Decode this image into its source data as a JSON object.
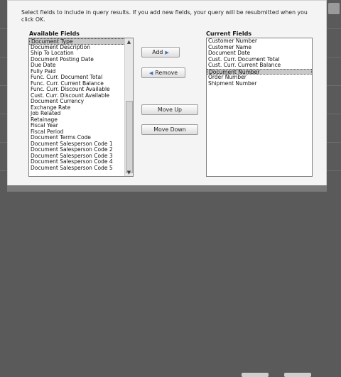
{
  "instructions": "Select fields to include in query results. If you add new fields, your query will be resubmitted when you click OK.",
  "available": {
    "label": "Available Fields",
    "items": [
      "Document Type",
      "Document Description",
      "Ship To Location",
      "Document Posting Date",
      "Due Date",
      "Fully Paid",
      "Func. Curr. Document Total",
      "Func. Curr. Current Balance",
      "Func. Curr. Discount Available",
      "Cust. Curr. Discount Available",
      "Document Currency",
      "Exchange Rate",
      "Job Related",
      "Retainage",
      "Fiscal Year",
      "Fiscal Period",
      "Document Terms Code",
      "Document Salesperson Code 1",
      "Document Salesperson Code 2",
      "Document Salesperson Code 3",
      "Document Salesperson Code 4",
      "Document Salesperson Code 5"
    ],
    "selected_index": 0
  },
  "current": {
    "label": "Current Fields",
    "items": [
      "Customer Number",
      "Customer Name",
      "Document Date",
      "Cust. Curr. Document Total",
      "Cust. Curr. Current Balance",
      "Document Number",
      "Order Number",
      "Shipment Number"
    ],
    "selected_index": 5
  },
  "buttons": {
    "add": "Add",
    "remove": "Remove",
    "move_up": "Move Up",
    "move_down": "Move Down"
  },
  "icons": {
    "add": "arrow-right-icon",
    "remove": "arrow-left-icon"
  }
}
